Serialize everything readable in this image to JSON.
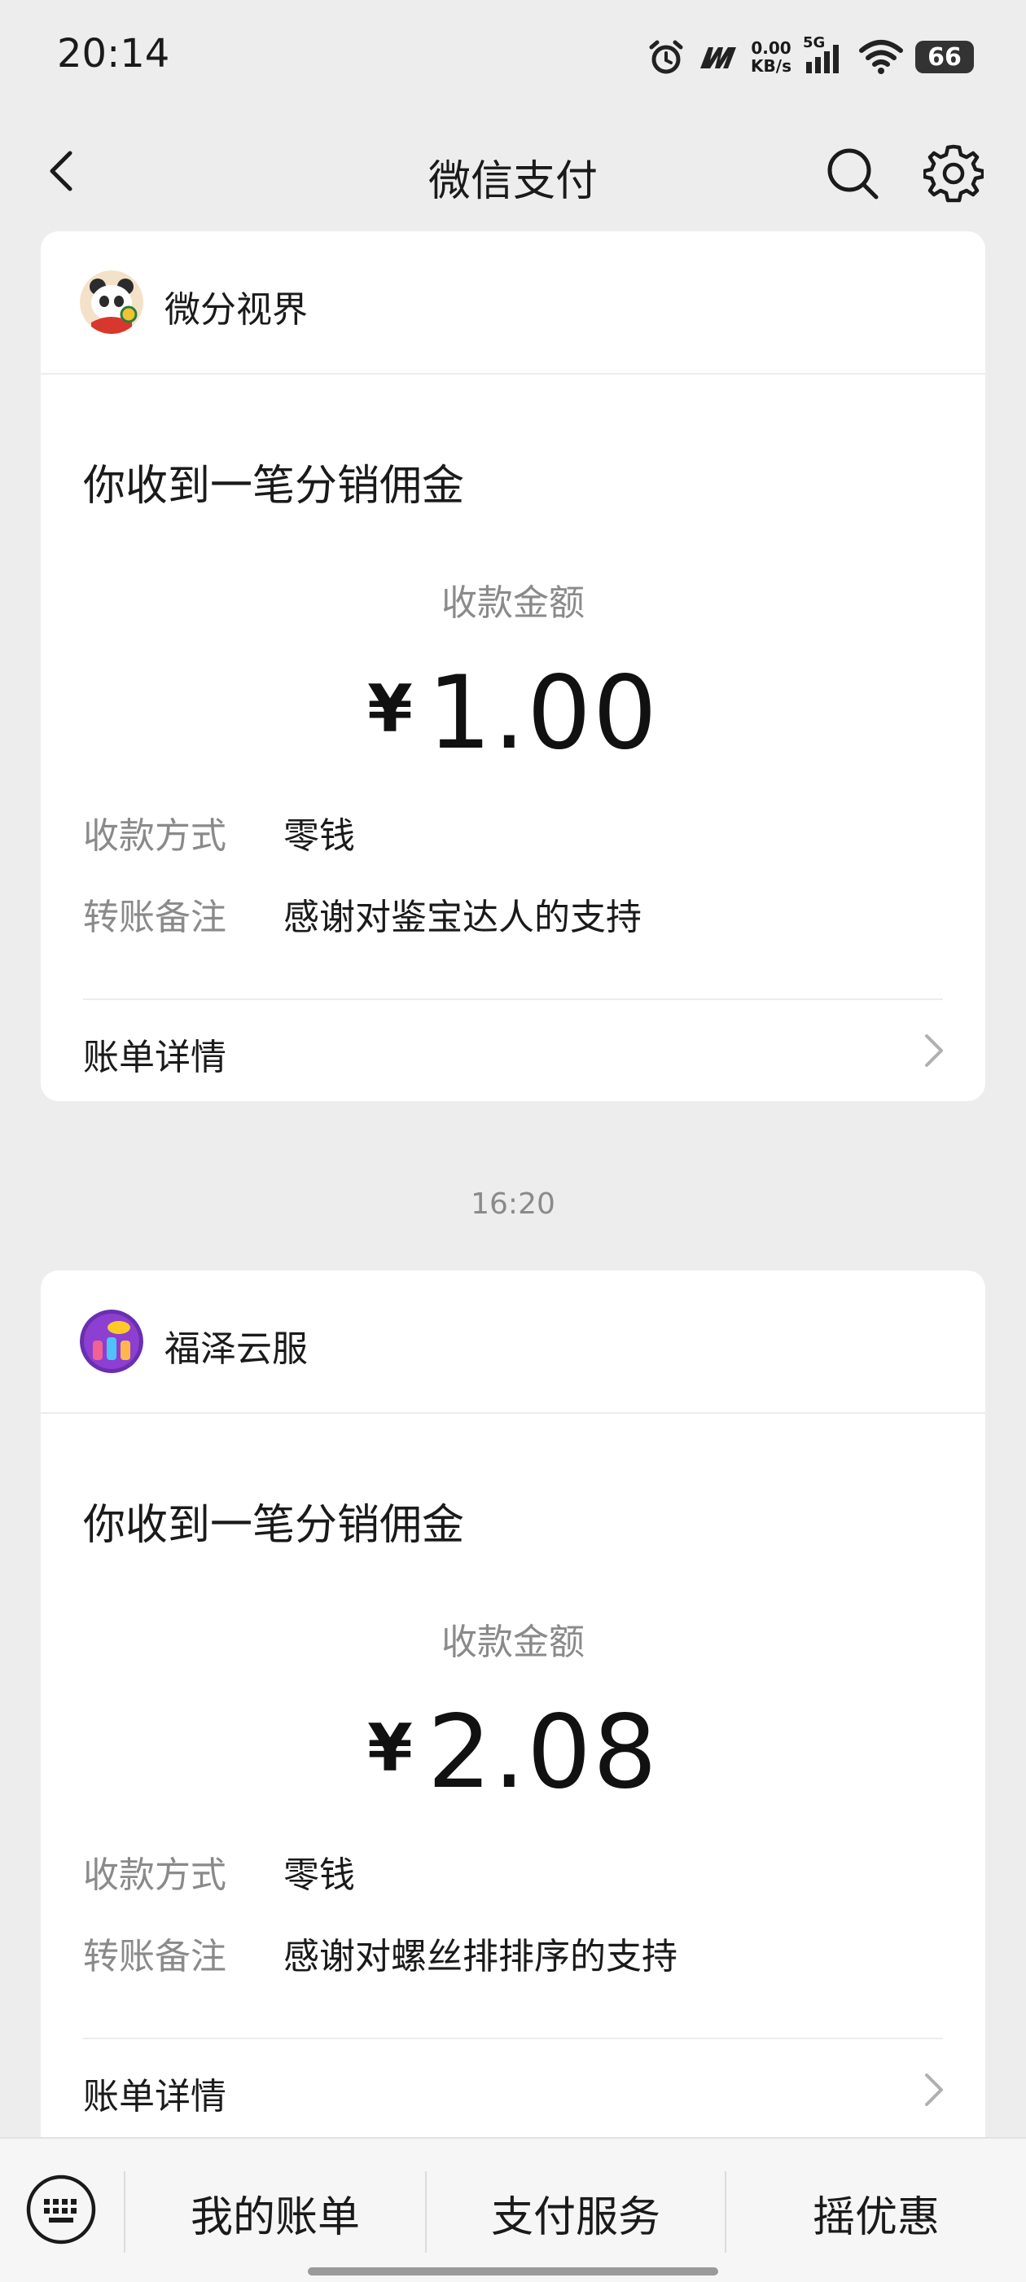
{
  "status_bar": {
    "time": "20:14",
    "speed_value": "0.00",
    "speed_unit": "KB/s",
    "network": "5G",
    "battery": "66"
  },
  "header": {
    "title": "微信支付"
  },
  "messages": [
    {
      "sender": "微分视界",
      "notice": "你收到一笔分销佣金",
      "amount_label": "收款金额",
      "currency": "¥",
      "amount": "1.00",
      "method_label": "收款方式",
      "method_value": "零钱",
      "remark_label": "转账备注",
      "remark_value": "感谢对鉴宝达人的支持",
      "detail_link": "账单详情"
    },
    {
      "timestamp": "16:20",
      "sender": "福泽云服",
      "notice": "你收到一笔分销佣金",
      "amount_label": "收款金额",
      "currency": "¥",
      "amount": "2.08",
      "method_label": "收款方式",
      "method_value": "零钱",
      "remark_label": "转账备注",
      "remark_value": "感谢对螺丝排排序的支持",
      "detail_link": "账单详情"
    }
  ],
  "bottom_bar": {
    "items": [
      "我的账单",
      "支付服务",
      "摇优惠"
    ]
  },
  "colors": {
    "background": "#ededed",
    "card": "#ffffff",
    "muted_text": "#8a8a8a",
    "primary_text": "#1a1a1a"
  }
}
